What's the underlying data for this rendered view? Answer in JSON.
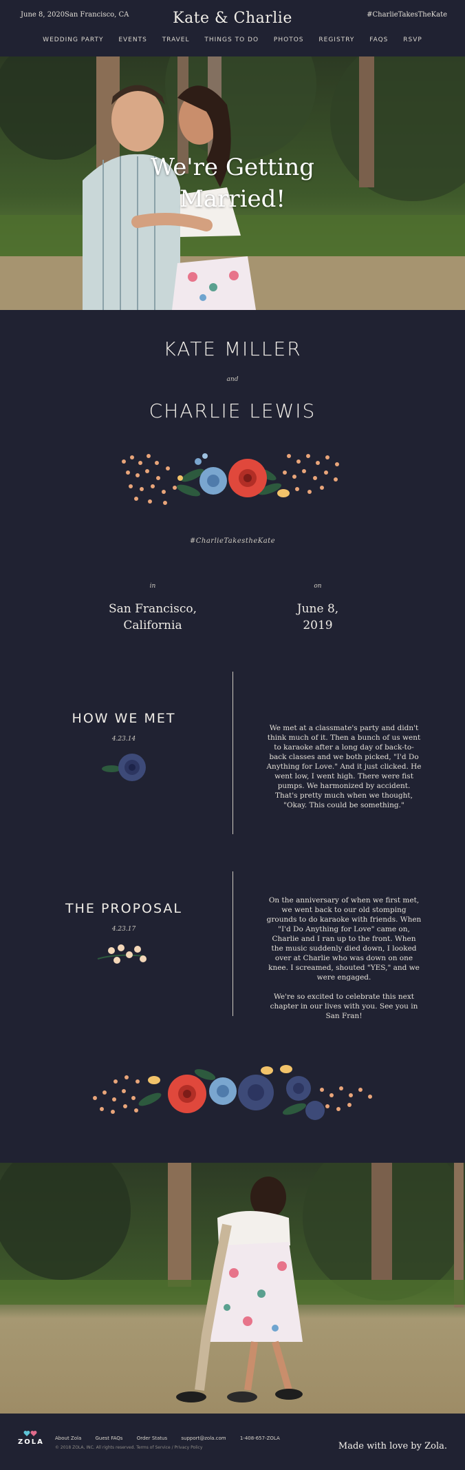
{
  "header": {
    "date": "June 8, 2020",
    "location": "San Francisco, CA",
    "title": "Kate & Charlie",
    "hashtag": "#CharlieTakesTheKate"
  },
  "nav": [
    "WEDDING PARTY",
    "EVENTS",
    "TRAVEL",
    "THINGS TO DO",
    "PHOTOS",
    "REGISTRY",
    "FAQS",
    "RSVP"
  ],
  "hero": {
    "headline_line1": "We're Getting",
    "headline_line2": "Married!"
  },
  "couple": {
    "name1": "KATE MILLER",
    "and": "and",
    "name2": "CHARLIE LEWIS",
    "hashtag": "#CharlieTakestheKate"
  },
  "details": {
    "in_label": "in",
    "place_line1": "San Francisco,",
    "place_line2": "California",
    "on_label": "on",
    "date_line1": "June 8,",
    "date_line2": "2019"
  },
  "story": [
    {
      "title": "HOW WE MET",
      "date": "4.23.14",
      "text": "We met at a classmate's party and didn't think much of it. Then a bunch of us went to karaoke after a long day of back-to-back classes and we both picked, \"I'd Do Anything for Love.\" And it just clicked. He went low, I went high. There were fist pumps. We harmonized by accident. That's pretty much when we thought, \"Okay. This could be something.\""
    },
    {
      "title": "THE PROPOSAL",
      "date": "4.23.17",
      "text": "On the anniversary of when we first met, we went back to our old stomping grounds to do karaoke with friends. When \"I'd Do Anything for Love\" came on, Charlie and I ran up to the front. When the music suddenly died down, I looked over at Charlie who was down on one knee. I screamed, shouted \"YES,\" and we were engaged.",
      "text2": "We're so excited to celebrate this next chapter in our lives with you. See you in San Fran!"
    }
  ],
  "footer": {
    "logo": "ZOLA",
    "links": [
      "About Zola",
      "Guest FAQs",
      "Order Status",
      "support@zola.com",
      "1-408-657-ZOLA"
    ],
    "copyright": "© 2018 ZOLA, INC.  All rights reserved.    Terms of Service  /  Privacy Policy",
    "made_with": "Made with love by Zola."
  },
  "colors": {
    "background": "#202232",
    "text": "#e9e6df",
    "accent_red": "#e0483c",
    "accent_blue": "#7aa6cf"
  }
}
